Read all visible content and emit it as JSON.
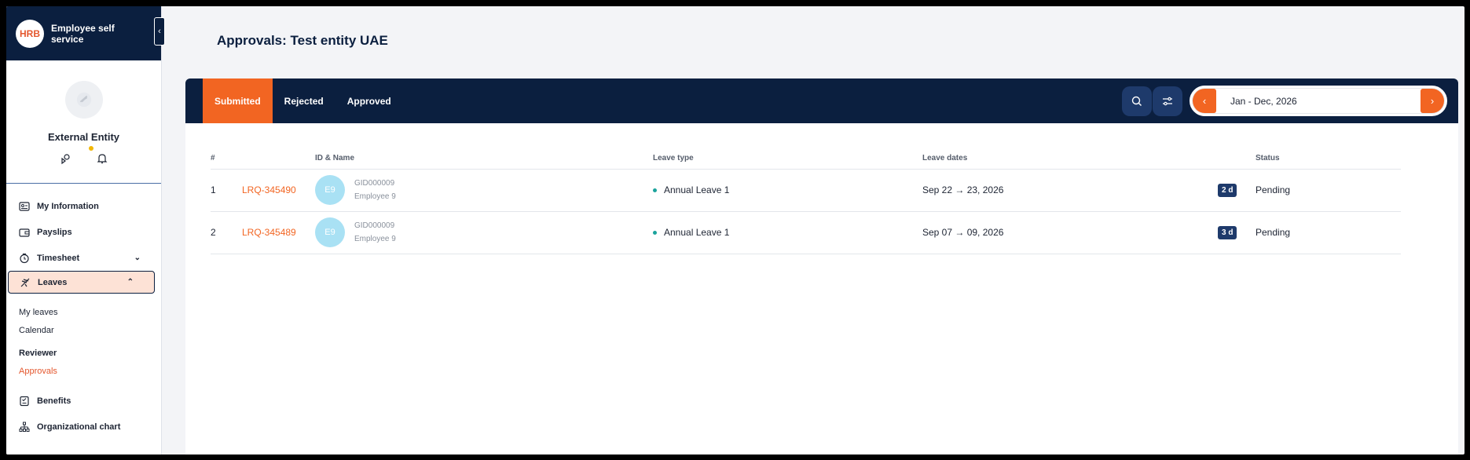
{
  "app": {
    "logo": "HRB",
    "title": "Employee self service",
    "collapse_icon": "‹"
  },
  "profile": {
    "name": "External Entity"
  },
  "nav": {
    "my_information": "My Information",
    "payslips": "Payslips",
    "timesheet": "Timesheet",
    "leaves": "Leaves",
    "leaves_sub": {
      "my_leaves": "My leaves",
      "calendar": "Calendar",
      "reviewer_heading": "Reviewer",
      "approvals": "Approvals"
    },
    "benefits": "Benefits",
    "org_chart": "Organizational chart"
  },
  "page": {
    "title": "Approvals: Test entity UAE"
  },
  "tabs": {
    "submitted": "Submitted",
    "rejected": "Rejected",
    "approved": "Approved"
  },
  "date_range": {
    "label": "Jan - Dec, 2026",
    "prev": "‹",
    "next": "›"
  },
  "table": {
    "headers": {
      "num": "#",
      "id_name": "ID & Name",
      "leave_type": "Leave type",
      "leave_dates": "Leave dates",
      "status": "Status"
    },
    "rows": [
      {
        "num": "1",
        "request_id": "LRQ-345490",
        "initials": "E9",
        "gid": "GID000009",
        "employee": "Employee 9",
        "leave_type": "Annual Leave 1",
        "dates": "Sep 22 → 23, 2026",
        "duration": "2 d",
        "status": "Pending"
      },
      {
        "num": "2",
        "request_id": "LRQ-345489",
        "initials": "E9",
        "gid": "GID000009",
        "employee": "Employee 9",
        "leave_type": "Annual Leave 1",
        "dates": "Sep 07 → 09, 2026",
        "duration": "3 d",
        "status": "Pending"
      }
    ]
  },
  "colors": {
    "navy": "#0b1f3f",
    "accent": "#f26522",
    "active_bg": "#fde2d6",
    "avatar": "#a9e1f4",
    "leave_dot": "#1ba39c"
  }
}
